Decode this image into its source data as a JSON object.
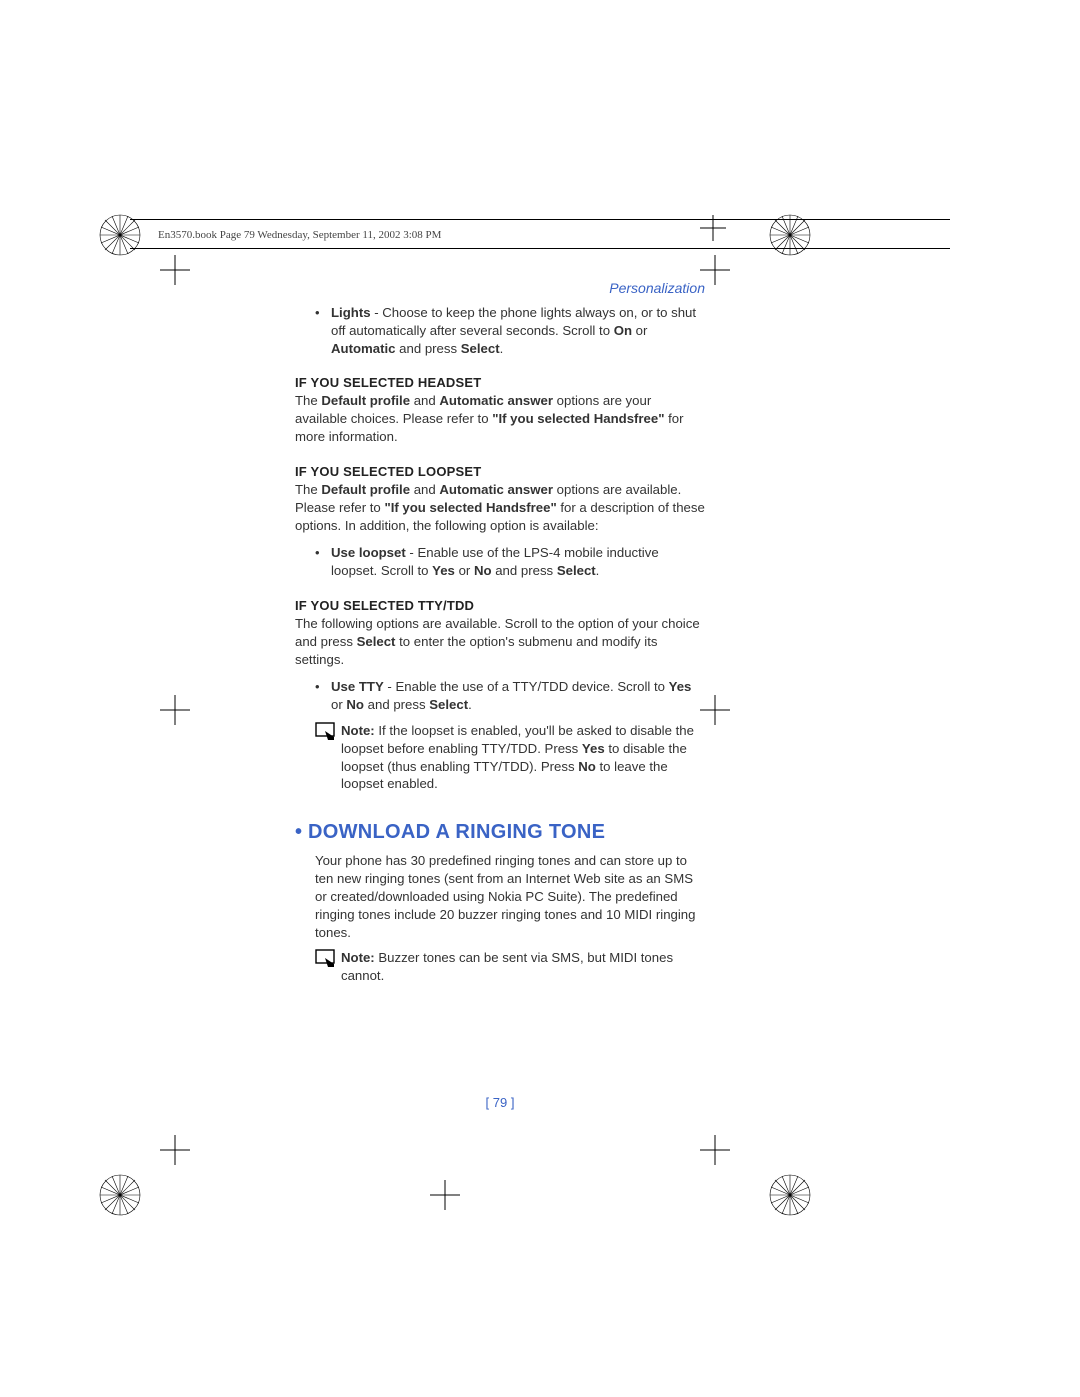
{
  "meta_header": "En3570.book  Page 79  Wednesday, September 11, 2002  3:08 PM",
  "section_label": "Personalization",
  "lights_bullet": {
    "lead": "Lights",
    "rest": " - Choose to keep the phone lights always on, or to shut off automatically after several seconds. Scroll to ",
    "b1": "On",
    "mid1": " or ",
    "b2": "Automatic",
    "mid2": " and press ",
    "b3": "Select",
    "tail": "."
  },
  "headset": {
    "title": "IF YOU SELECTED HEADSET",
    "t1": "The ",
    "b1": "Default profile",
    "t2": " and ",
    "b2": "Automatic answer",
    "t3": " options are your available choices. Please refer to ",
    "b3": "\"If you selected Handsfree\"",
    "t4": " for more information."
  },
  "loopset": {
    "title": "IF YOU SELECTED LOOPSET",
    "t1": "The ",
    "b1": "Default profile",
    "t2": " and ",
    "b2": "Automatic answer",
    "t3": " options are available. Please refer to ",
    "b3": "\"If you selected Handsfree\"",
    "t4": " for a description of these options. In addition, the following option is available:",
    "bullet_lead": "Use loopset",
    "bullet_rest1": " - Enable use of the LPS-4 mobile inductive loopset. Scroll to ",
    "bullet_b1": "Yes",
    "bullet_mid": " or ",
    "bullet_b2": "No",
    "bullet_rest2": " and press ",
    "bullet_b3": "Select",
    "bullet_tail": "."
  },
  "tty": {
    "title": "IF YOU SELECTED TTY/TDD",
    "intro1": "The following options are available. Scroll to the option of your choice and press ",
    "intro_b": "Select",
    "intro2": " to enter the option's submenu and modify its settings.",
    "bullet_lead": "Use TTY",
    "bullet_rest1": " - Enable the use of a TTY/TDD device. Scroll to ",
    "bullet_b1": "Yes",
    "bullet_mid": " or ",
    "bullet_b2": "No",
    "bullet_rest2": " and press ",
    "bullet_b3": "Select",
    "bullet_tail": ".",
    "note_lead": "Note:",
    "note1": " If the loopset is enabled, you'll be asked to disable the loopset before enabling TTY/TDD. Press ",
    "note_b1": "Yes",
    "note2": " to disable the loopset (thus enabling TTY/TDD). Press ",
    "note_b2": "No",
    "note3": " to leave the loopset enabled."
  },
  "download": {
    "title": "DOWNLOAD A RINGING TONE",
    "para": "Your phone has 30 predefined ringing tones and can store up to ten new ringing tones (sent from an Internet Web site as an SMS or created/downloaded using Nokia PC Suite). The predefined ringing tones include 20 buzzer ringing tones and 10 MIDI ringing tones.",
    "note_lead": "Note:",
    "note_rest": " Buzzer tones can be sent via SMS, but MIDI tones cannot."
  },
  "page_number": "[ 79 ]"
}
